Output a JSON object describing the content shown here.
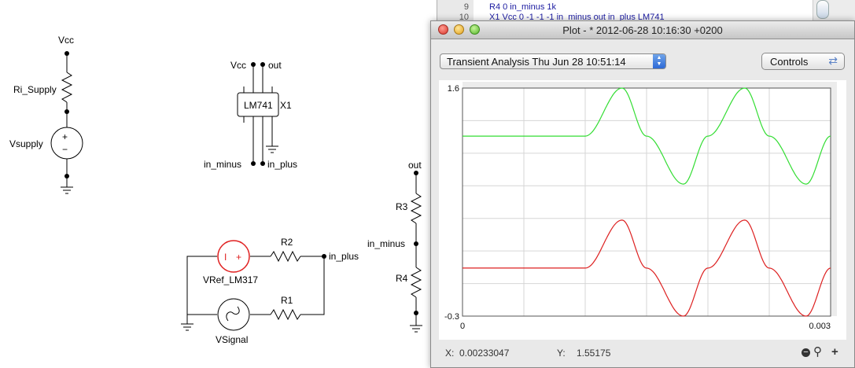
{
  "schematic": {
    "labels": {
      "vcc_left": "Vcc",
      "ri_supply": "Ri_Supply",
      "vsupply": "Vsupply",
      "vcc_opamp": "Vcc",
      "out_opamp": "out",
      "lm741": "LM741",
      "x1": "X1",
      "in_minus_opamp": "in_minus",
      "in_plus_opamp": "in_plus",
      "out_right": "out",
      "r3": "R3",
      "in_minus_right": "in_minus",
      "r4": "R4",
      "r2": "R2",
      "in_plus_right": "in_plus",
      "vref": "VRef_LM317",
      "r1": "R1",
      "vsignal": "VSignal",
      "plus": "+",
      "minus": "−",
      "i_symbol": "I"
    },
    "colors": {
      "wire": "#000000",
      "source_red": "#e02020"
    }
  },
  "netlist": {
    "lines": [
      {
        "num": "9",
        "text": "R4 0 in_minus 1k"
      },
      {
        "num": "10",
        "text": "X1 Vcc 0 -1 -1 -1 in_minus out in_plus LM741"
      }
    ]
  },
  "plot_window": {
    "title": "Plot - * 2012-06-28 10:16:30 +0200",
    "analysis_select": {
      "value": "Transient Analysis  Thu Jun 28 10:51:14"
    },
    "controls_label": "Controls",
    "readout": {
      "x_label": "X:",
      "x_value": "0.00233047",
      "y_label": "Y:",
      "y_value": "1.55175"
    },
    "zoom": {
      "out_label": "−",
      "in_label": "+"
    }
  },
  "chart_data": {
    "type": "line",
    "title": "",
    "xlabel": "",
    "ylabel": "",
    "xlim": [
      0,
      0.003
    ],
    "ylim": [
      -0.3,
      1.6
    ],
    "x_tick_labels": [
      "0",
      "0.003"
    ],
    "y_tick_labels": [
      "1.6",
      "-0.3"
    ],
    "grid": true,
    "series": [
      {
        "color": "#33dd33",
        "x": [
          0,
          0.001,
          0.0013,
          0.0015,
          0.0018,
          0.002,
          0.0023,
          0.0025,
          0.0028,
          0.003
        ],
        "y": [
          1.2,
          1.2,
          1.6,
          1.2,
          0.8,
          1.2,
          1.6,
          1.2,
          0.8,
          1.2
        ]
      },
      {
        "color": "#dd2020",
        "x": [
          0,
          0.001,
          0.0013,
          0.0015,
          0.0018,
          0.002,
          0.0023,
          0.0025,
          0.0028,
          0.003
        ],
        "y": [
          0.1,
          0.1,
          0.5,
          0.1,
          -0.3,
          0.1,
          0.5,
          0.1,
          -0.3,
          0.1
        ]
      }
    ]
  }
}
